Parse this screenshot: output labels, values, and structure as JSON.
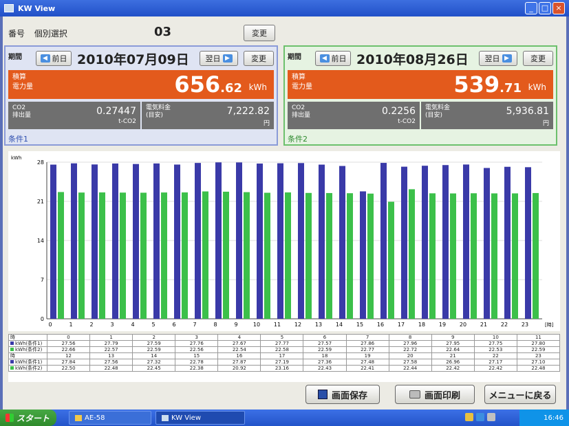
{
  "window": {
    "title": "KW View"
  },
  "header": {
    "label_no": "番号",
    "label_select": "個別選択",
    "number": "03",
    "change": "変更"
  },
  "panels": [
    {
      "period": "期間",
      "prev": "前日",
      "date": "2010年07月09日",
      "next": "翌日",
      "change": "変更",
      "energy_label1": "積算",
      "energy_label2": "電力量",
      "energy_int": "656",
      "energy_dec": ".62",
      "energy_unit": "kWh",
      "co2_label1": "CO2",
      "co2_label2": "排出量",
      "co2_val": "0.27447",
      "co2_unit": "t-CO2",
      "cost_label1": "電気料金",
      "cost_label2": "(目安)",
      "cost_val": "7,222.82",
      "cost_unit": "円",
      "cond": "条件1"
    },
    {
      "period": "期間",
      "prev": "前日",
      "date": "2010年08月26日",
      "next": "翌日",
      "change": "変更",
      "energy_label1": "積算",
      "energy_label2": "電力量",
      "energy_int": "539",
      "energy_dec": ".71",
      "energy_unit": "kWh",
      "co2_label1": "CO2",
      "co2_label2": "排出量",
      "co2_val": "0.2256",
      "co2_unit": "t-CO2",
      "cost_label1": "電気料金",
      "cost_label2": "(目安)",
      "cost_val": "5,936.81",
      "cost_unit": "円",
      "cond": "条件2"
    }
  ],
  "chart_data": {
    "type": "bar",
    "ylabel": "kWh",
    "xlabel": "[時]",
    "ylim": [
      0,
      28
    ],
    "yticks": [
      "0",
      "7",
      "14",
      "21",
      "28"
    ],
    "categories": [
      "0",
      "1",
      "2",
      "3",
      "4",
      "5",
      "6",
      "7",
      "8",
      "9",
      "10",
      "11",
      "12",
      "13",
      "14",
      "15",
      "16",
      "17",
      "18",
      "19",
      "20",
      "21",
      "22",
      "23"
    ],
    "series": [
      {
        "name": "kWh(条件1)",
        "color": "#3a3aa8",
        "values": [
          27.56,
          27.79,
          27.59,
          27.76,
          27.67,
          27.77,
          27.57,
          27.86,
          27.96,
          27.95,
          27.75,
          27.8,
          27.84,
          27.56,
          27.32,
          22.78,
          27.87,
          27.19,
          27.36,
          27.48,
          27.58,
          26.96,
          27.17,
          27.1
        ]
      },
      {
        "name": "kWh(条件2)",
        "color": "#3cc04a",
        "values": [
          22.66,
          22.57,
          22.59,
          22.56,
          22.54,
          22.58,
          22.59,
          22.77,
          22.72,
          22.64,
          22.53,
          22.59,
          22.5,
          22.48,
          22.45,
          22.38,
          20.92,
          23.16,
          22.43,
          22.41,
          22.44,
          22.42,
          22.42,
          22.48
        ]
      }
    ]
  },
  "table": {
    "hour_label": "時",
    "row1_label": "kWh(条件1)",
    "row2_label": "kWh(条件2)",
    "hours_a": [
      "0",
      "1",
      "2",
      "3",
      "4",
      "5",
      "6",
      "7",
      "8",
      "9",
      "10",
      "11"
    ],
    "hours_b": [
      "12",
      "13",
      "14",
      "15",
      "16",
      "17",
      "18",
      "19",
      "20",
      "21",
      "22",
      "23"
    ],
    "c1_a": [
      "27.56",
      "27.79",
      "27.59",
      "27.76",
      "27.67",
      "27.77",
      "27.57",
      "27.86",
      "27.96",
      "27.95",
      "27.75",
      "27.80"
    ],
    "c2_a": [
      "22.66",
      "22.57",
      "22.59",
      "22.56",
      "22.54",
      "22.58",
      "22.59",
      "22.77",
      "22.72",
      "22.64",
      "22.53",
      "22.59"
    ],
    "c1_b": [
      "27.84",
      "27.56",
      "27.32",
      "22.78",
      "27.87",
      "27.19",
      "27.36",
      "27.48",
      "27.58",
      "26.96",
      "27.17",
      "27.10"
    ],
    "c2_b": [
      "22.50",
      "22.48",
      "22.45",
      "22.38",
      "20.92",
      "23.16",
      "22.43",
      "22.41",
      "22.44",
      "22.42",
      "22.42",
      "22.48"
    ]
  },
  "footer": {
    "save": "画面保存",
    "print": "画面印刷",
    "menu": "メニューに戻る"
  },
  "taskbar": {
    "start": "スタート",
    "task1": "AE-58",
    "task2": "KW View",
    "clock": "16:46"
  }
}
